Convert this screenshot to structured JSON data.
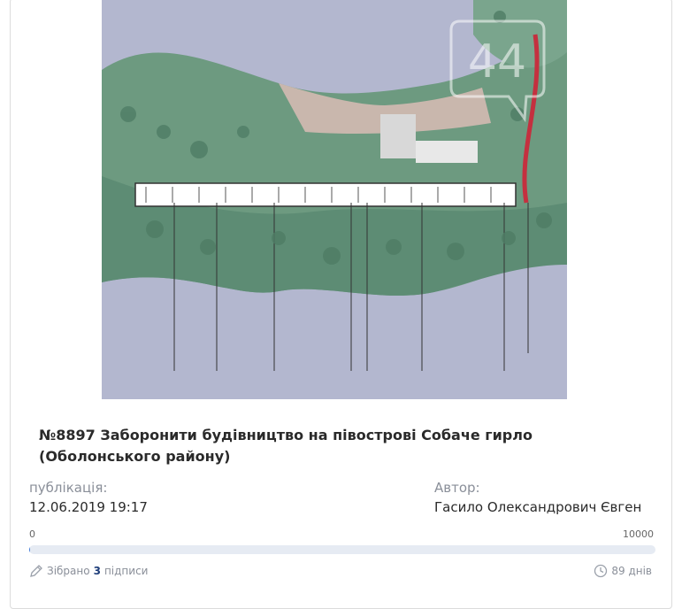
{
  "petition": {
    "title": "№8897 Заборонити будівництво на півострові Собаче гирло (Оболонського району)",
    "map_watermark": "44"
  },
  "meta": {
    "published_label": "публікація:",
    "published_value": "12.06.2019 19:17",
    "author_label": "Автор:",
    "author_value": "Гасило Олександрович Євген"
  },
  "progress": {
    "min_label": "0",
    "max_label": "10000",
    "collected": 3,
    "goal": 10000
  },
  "footer": {
    "collected_prefix": "Зібрано",
    "collected_count": "3",
    "collected_suffix": "підписи",
    "days_left": "89 днів"
  },
  "colors": {
    "water": "#b3b7cf",
    "land": "#6d9a80",
    "accent": "#3c78d8"
  }
}
